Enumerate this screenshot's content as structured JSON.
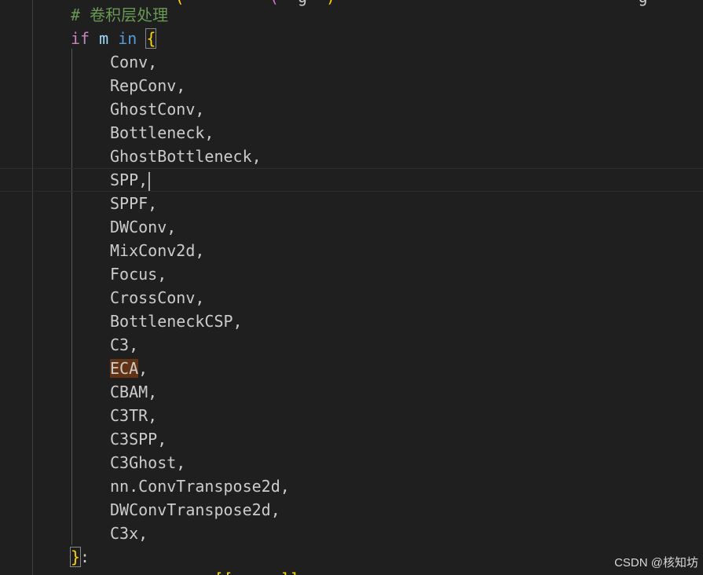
{
  "editor": {
    "comment": "# 卷积层处理",
    "if_keyword": "if",
    "loop_var": "m",
    "in_keyword": "in",
    "open_brace": "{",
    "close_brace": "}",
    "close_colon": ":",
    "current_item": "SPP,",
    "highlighted_item": "ECA",
    "items_before_current": [
      "Conv,",
      "RepConv,",
      "GhostConv,",
      "Bottleneck,",
      "GhostBottleneck,"
    ],
    "items_middle": [
      "SPPF,",
      "DWConv,",
      "MixConv2d,",
      "Focus,",
      "CrossConv,",
      "BottleneckCSP,",
      "C3,"
    ],
    "items_after_highlight": [
      "CBAM,",
      "C3TR,",
      "C3SPP,",
      "C3Ghost,",
      "nn.ConvTranspose2d,",
      "DWConvTranspose2d,",
      "C3x,"
    ],
    "colors": {
      "background": "#1f1f1f",
      "comment": "#6a9955",
      "control_keyword": "#c586c0",
      "keyword": "#569cd6",
      "variable": "#9cdcfe",
      "brace": "#ffd700",
      "find_highlight": "#613214"
    }
  },
  "watermark": "CSDN @核知坊"
}
